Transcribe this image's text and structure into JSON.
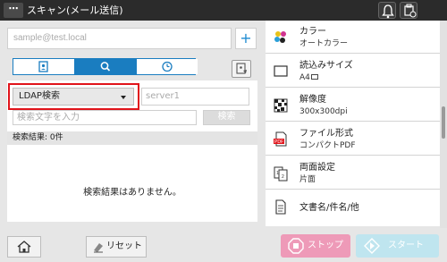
{
  "titlebar": {
    "menu_label": "⋯",
    "title": "スキャン(メール送信)",
    "icons": [
      "bell-icon",
      "device-status-icon"
    ]
  },
  "address": {
    "placeholder": "sample@test.local",
    "add_label": "+"
  },
  "tabs": [
    {
      "icon": "address-book-icon",
      "active": false
    },
    {
      "icon": "search-icon",
      "active": true
    },
    {
      "icon": "history-clock-icon",
      "active": false
    }
  ],
  "search": {
    "ldap_selected": "LDAP検索",
    "server_placeholder": "server1",
    "keyword_placeholder": "検索文字を入力",
    "search_button": "検索",
    "result_label": "検索結果:",
    "result_count": "0件",
    "no_results": "検索結果はありません。"
  },
  "settings": [
    {
      "title": "カラー",
      "value": "オートカラー",
      "icon": "color-dots-icon"
    },
    {
      "title": "読込みサイズ",
      "value": "A4",
      "icon": "paper-size-icon"
    },
    {
      "title": "解像度",
      "value": "300x300dpi",
      "icon": "resolution-grid-icon"
    },
    {
      "title": "ファイル形式",
      "value": "コンパクトPDF",
      "icon": "pdf-file-icon"
    },
    {
      "title": "両面設定",
      "value": "片面",
      "icon": "duplex-pages-icon"
    },
    {
      "title": "文書名/件名/他",
      "value": "",
      "icon": "document-icon"
    }
  ],
  "bottom": {
    "reset_label": "リセット",
    "stop_label": "ストップ",
    "start_label": "スタート"
  },
  "colors": {
    "accent": "#1a7dc0",
    "highlight": "#e1141b",
    "stop": "#ee9ab8",
    "start": "#bfe5ef"
  }
}
